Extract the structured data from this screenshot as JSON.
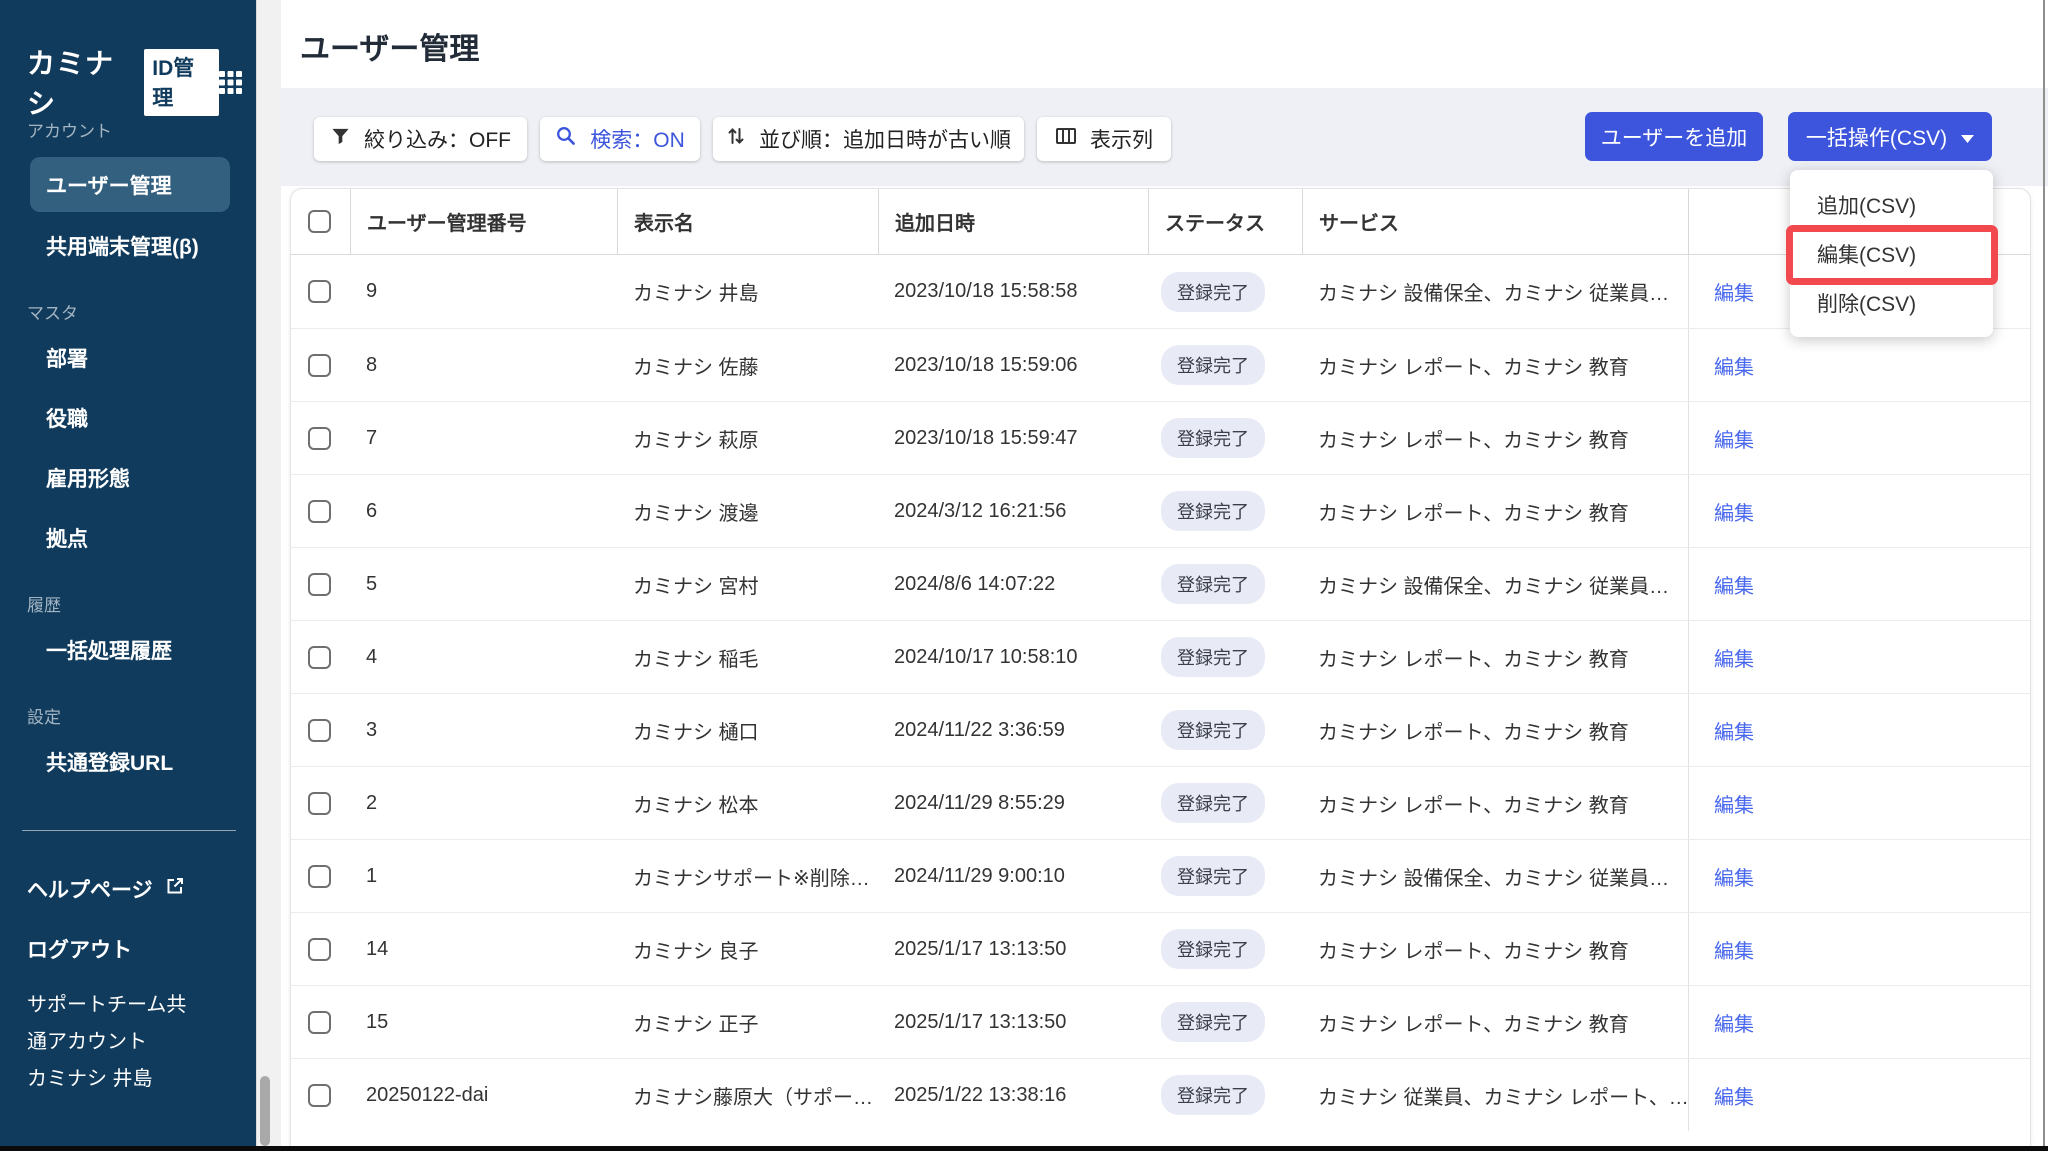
{
  "brand": {
    "logo_text": "カミナシ",
    "logo_badge": "ID管理"
  },
  "header": {
    "title": "ユーザー管理"
  },
  "sidebar": {
    "sections": [
      {
        "label": "アカウント",
        "items": [
          {
            "label": "ユーザー管理",
            "active": true
          },
          {
            "label": "共用端末管理(β)"
          }
        ]
      },
      {
        "label": "マスタ",
        "items": [
          {
            "label": "部署"
          },
          {
            "label": "役職"
          },
          {
            "label": "雇用形態"
          },
          {
            "label": "拠点"
          }
        ]
      },
      {
        "label": "履歴",
        "items": [
          {
            "label": "一括処理履歴"
          }
        ]
      },
      {
        "label": "設定",
        "items": [
          {
            "label": "共通登録URL"
          }
        ]
      }
    ],
    "footer_links": [
      {
        "label": "ヘルプページ",
        "external": true
      },
      {
        "label": "ログアウト"
      }
    ],
    "account_name": "サポートチーム共通アカウント",
    "user_name": "カミナシ 井島"
  },
  "toolbar": {
    "filter": "絞り込み：OFF",
    "search": "検索：ON",
    "sort": "並び順：追加日時が古い順",
    "columns": "表示列",
    "add_user": "ユーザーを追加",
    "bulk": "一括操作(CSV)"
  },
  "dropdown": {
    "items": [
      "追加(CSV)",
      "編集(CSV)",
      "削除(CSV)"
    ],
    "highlighted": "編集(CSV)"
  },
  "table": {
    "headers": [
      "ユーザー管理番号",
      "表示名",
      "追加日時",
      "ステータス",
      "サービス"
    ],
    "edit_label": "編集",
    "rows": [
      {
        "id": "9",
        "name": "カミナシ 井島",
        "date": "2023/10/18 15:58:58",
        "status": "登録完了",
        "services": "カミナシ 設備保全、カミナシ 従業員…"
      },
      {
        "id": "8",
        "name": "カミナシ 佐藤",
        "date": "2023/10/18 15:59:06",
        "status": "登録完了",
        "services": "カミナシ レポート、カミナシ 教育"
      },
      {
        "id": "7",
        "name": "カミナシ 萩原",
        "date": "2023/10/18 15:59:47",
        "status": "登録完了",
        "services": "カミナシ レポート、カミナシ 教育"
      },
      {
        "id": "6",
        "name": "カミナシ 渡邊",
        "date": "2024/3/12 16:21:56",
        "status": "登録完了",
        "services": "カミナシ レポート、カミナシ 教育"
      },
      {
        "id": "5",
        "name": "カミナシ 宮村",
        "date": "2024/8/6 14:07:22",
        "status": "登録完了",
        "services": "カミナシ 設備保全、カミナシ 従業員…"
      },
      {
        "id": "4",
        "name": "カミナシ 稲毛",
        "date": "2024/10/17 10:58:10",
        "status": "登録完了",
        "services": "カミナシ レポート、カミナシ 教育"
      },
      {
        "id": "3",
        "name": "カミナシ 樋口",
        "date": "2024/11/22 3:36:59",
        "status": "登録完了",
        "services": "カミナシ レポート、カミナシ 教育"
      },
      {
        "id": "2",
        "name": "カミナシ 松本",
        "date": "2024/11/29 8:55:29",
        "status": "登録完了",
        "services": "カミナシ レポート、カミナシ 教育"
      },
      {
        "id": "1",
        "name": "カミナシサポート※削除…",
        "date": "2024/11/29 9:00:10",
        "status": "登録完了",
        "services": "カミナシ 設備保全、カミナシ 従業員…"
      },
      {
        "id": "14",
        "name": "カミナシ 良子",
        "date": "2025/1/17 13:13:50",
        "status": "登録完了",
        "services": "カミナシ レポート、カミナシ 教育"
      },
      {
        "id": "15",
        "name": "カミナシ 正子",
        "date": "2025/1/17 13:13:50",
        "status": "登録完了",
        "services": "カミナシ レポート、カミナシ 教育"
      },
      {
        "id": "20250122-dai",
        "name": "カミナシ藤原大（サポー…",
        "date": "2025/1/22 13:38:16",
        "status": "登録完了",
        "services": "カミナシ 従業員、カミナシ レポート、…"
      }
    ]
  },
  "colors": {
    "sidebar_bg": "#113B5C",
    "sidebar_active_bg": "#346080",
    "accent_blue": "#3D55DC",
    "link_blue": "#4A68ED",
    "highlight_red": "#F2494F",
    "toolbar_bg": "#EEF0F5",
    "status_pill_bg": "#E8EAF5"
  }
}
